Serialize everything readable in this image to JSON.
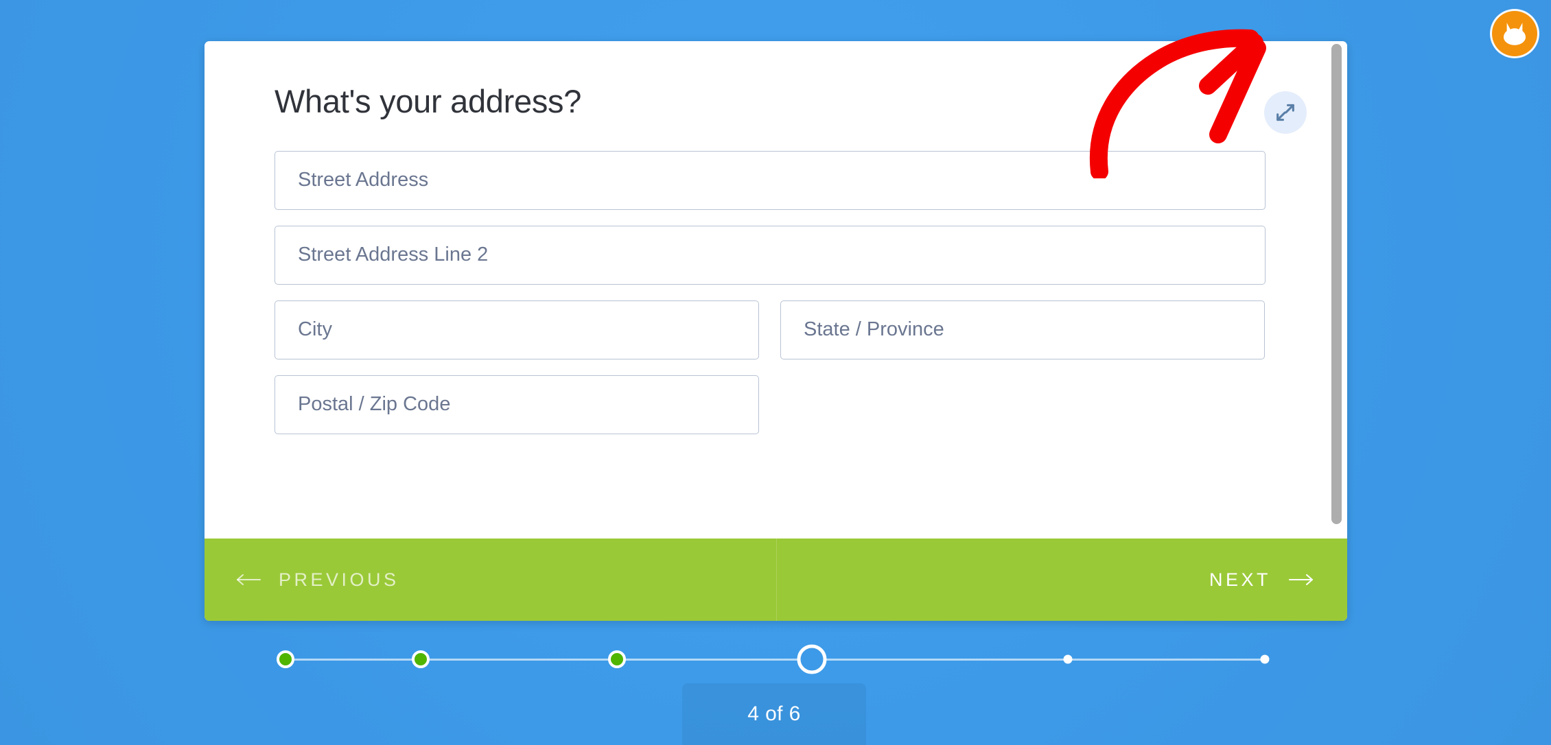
{
  "brand": {
    "icon": "cat-face-icon",
    "color": "#f5920b"
  },
  "card": {
    "title": "What's your address?",
    "expand_button": {
      "icon": "expand-arrows-icon",
      "label": "Expand"
    },
    "fields": [
      {
        "name": "street-address",
        "placeholder": "Street Address",
        "value": "",
        "width": "full"
      },
      {
        "name": "street-address-2",
        "placeholder": "Street Address Line 2",
        "value": "",
        "width": "full"
      },
      {
        "name": "city",
        "placeholder": "City",
        "value": "",
        "width": "half"
      },
      {
        "name": "state-province",
        "placeholder": "State / Province",
        "value": "",
        "width": "half"
      },
      {
        "name": "postal-zip",
        "placeholder": "Postal / Zip Code",
        "value": "",
        "width": "half"
      }
    ],
    "footer": {
      "previous_label": "PREVIOUS",
      "next_label": "NEXT",
      "background": "#9ac938"
    }
  },
  "progress": {
    "current_step": 4,
    "total_steps": 6,
    "counter_text": "4 of 6",
    "steps": [
      {
        "index": 1,
        "state": "done"
      },
      {
        "index": 2,
        "state": "done"
      },
      {
        "index": 3,
        "state": "done"
      },
      {
        "index": 4,
        "state": "current"
      },
      {
        "index": 5,
        "state": "todo"
      },
      {
        "index": 6,
        "state": "todo"
      }
    ],
    "done_color": "#4fb500",
    "current_color": "#3d9ae8"
  },
  "annotation": {
    "type": "curved-arrow",
    "color": "#f50000",
    "points_to": "expand-button"
  },
  "colors": {
    "background": "#3d9ae8",
    "card": "#ffffff",
    "accent_green": "#9ac938",
    "field_border": "#b8c3d4",
    "placeholder": "#6a7690",
    "title": "#30333a"
  }
}
